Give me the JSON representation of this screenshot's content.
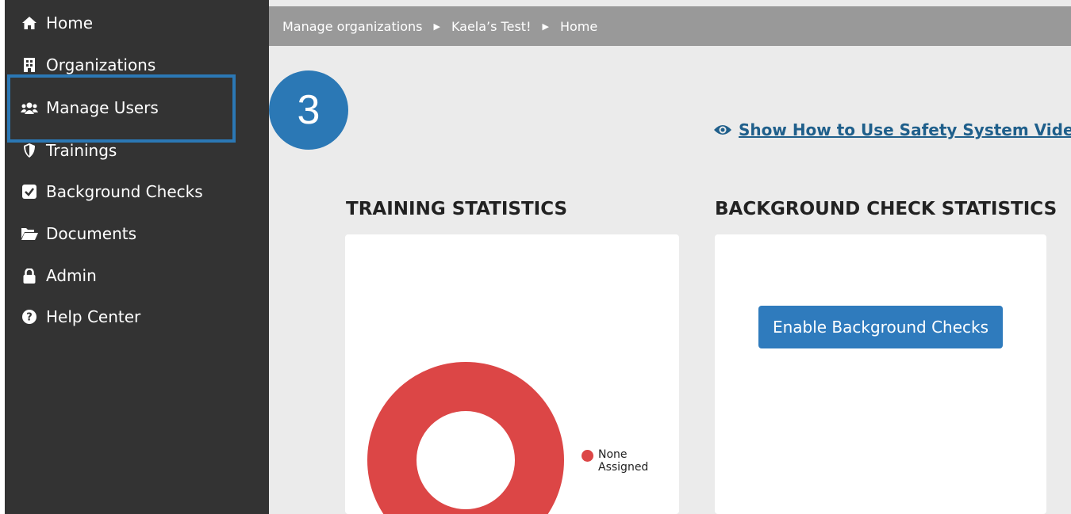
{
  "sidebar": {
    "items": [
      {
        "label": "Home",
        "icon": "home-icon"
      },
      {
        "label": "Organizations",
        "icon": "building-icon"
      },
      {
        "label": "Manage Users",
        "icon": "users-icon"
      },
      {
        "label": "Trainings",
        "icon": "shield-icon"
      },
      {
        "label": "Background Checks",
        "icon": "checkbox-icon"
      },
      {
        "label": "Documents",
        "icon": "folder-open-icon"
      },
      {
        "label": "Admin",
        "icon": "lock-icon"
      },
      {
        "label": "Help Center",
        "icon": "question-circle-icon"
      }
    ]
  },
  "breadcrumb": {
    "items": [
      "Manage organizations",
      "Kaela’s Test!",
      "Home"
    ],
    "separator_icon": "caret-right-icon"
  },
  "video_link": {
    "label": " Show How to Use Safety System Video",
    "icon": "eye-icon"
  },
  "training": {
    "title": "TRAINING STATISTICS",
    "chart_data": {
      "type": "pie",
      "categories": [
        "None Assigned"
      ],
      "values": [
        100
      ],
      "colors": [
        "#dc4646"
      ],
      "legend_position": "right"
    },
    "legend_line1": "None",
    "legend_line2": "Assigned"
  },
  "background": {
    "title": "BACKGROUND CHECK STATISTICS",
    "button_label": "Enable Background Checks"
  },
  "annotation": {
    "step_number": "3",
    "color": "#2b78b5"
  },
  "colors": {
    "sidebar_bg": "#333333",
    "topbar_bg": "#999999",
    "main_bg": "#ebebeb",
    "accent": "#2f7bbd",
    "chart_red": "#dc4646"
  }
}
